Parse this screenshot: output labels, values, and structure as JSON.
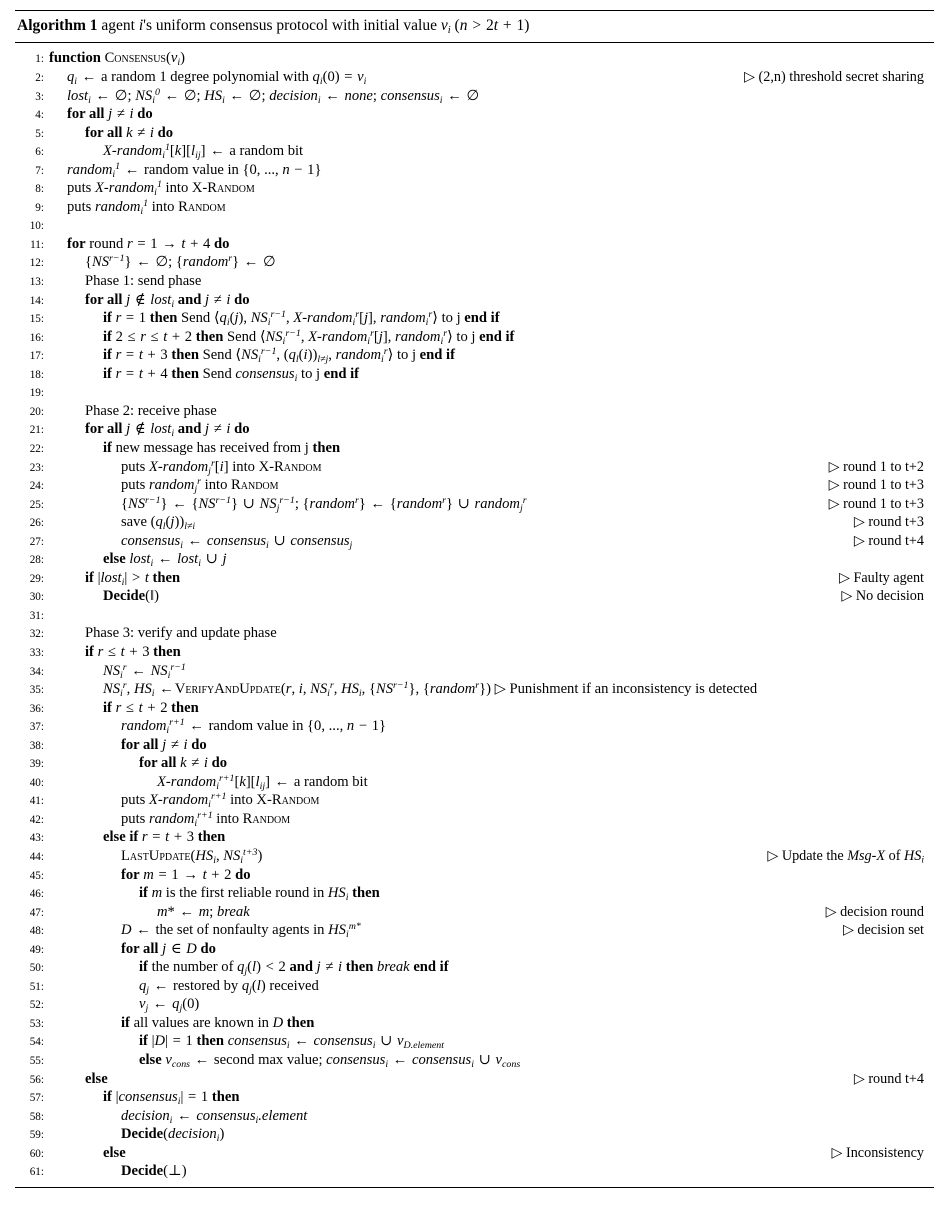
{
  "document": {
    "type": "algorithm-pseudocode",
    "caption": {
      "label": "Algorithm 1",
      "title": "agent i's uniform consensus protocol with initial value v_i (n > 2t + 1)"
    }
  },
  "algorithm": {
    "name": "Consensus",
    "argument": "v_i",
    "total_lines": 61,
    "lines": [
      {
        "n": "1",
        "indent": 0,
        "text": "function CONSENSUS(v_i)",
        "comment": ""
      },
      {
        "n": "2",
        "indent": 1,
        "text": "q_i <- a random 1 degree polynomial with q_i(0) = v_i",
        "comment": "(2,n) threshold secret sharing"
      },
      {
        "n": "3",
        "indent": 1,
        "text": "lost_i <- {}; NS_i^0 <- {}; HS_i <- {}; decision_i <- none; consensus_i <- {}",
        "comment": ""
      },
      {
        "n": "4",
        "indent": 1,
        "text": "for all j != i do",
        "comment": ""
      },
      {
        "n": "5",
        "indent": 2,
        "text": "for all k != i do",
        "comment": ""
      },
      {
        "n": "6",
        "indent": 3,
        "text": "X-random_i^1[k][l_ij] <- a random bit",
        "comment": ""
      },
      {
        "n": "7",
        "indent": 1,
        "text": "random_i^1 <- random value in {0, ..., n - 1}",
        "comment": ""
      },
      {
        "n": "8",
        "indent": 1,
        "text": "puts X-random_i^1 into X-RANDOM",
        "comment": ""
      },
      {
        "n": "9",
        "indent": 1,
        "text": "puts random_i^1 into RANDOM",
        "comment": ""
      },
      {
        "n": "10",
        "indent": 1,
        "text": "",
        "comment": ""
      },
      {
        "n": "11",
        "indent": 1,
        "text": "for round r = 1 -> t + 4 do",
        "comment": ""
      },
      {
        "n": "12",
        "indent": 2,
        "text": "{NS^{r-1}} <- {}; {random^r} <- {}",
        "comment": ""
      },
      {
        "n": "13",
        "indent": 2,
        "text": "Phase 1: send phase",
        "comment": ""
      },
      {
        "n": "14",
        "indent": 2,
        "text": "for all j not-in lost_i and j != i do",
        "comment": ""
      },
      {
        "n": "15",
        "indent": 3,
        "text": "if r = 1 then Send <q_i(j), NS_i^{r-1}, X-random_i^r[j], random_i^r> to j end if",
        "comment": ""
      },
      {
        "n": "16",
        "indent": 3,
        "text": "if 2 <= r <= t + 2 then Send <NS_i^{r-1}, X-random_i^r[j], random_i^r> to j end if",
        "comment": ""
      },
      {
        "n": "17",
        "indent": 3,
        "text": "if r = t + 3 then Send <NS_i^{r-1}, (q_l(i))_{l != j}, random_i^r> to j end if",
        "comment": ""
      },
      {
        "n": "18",
        "indent": 3,
        "text": "if r = t + 4 then Send consensus_i to j end if",
        "comment": ""
      },
      {
        "n": "19",
        "indent": 0,
        "text": "",
        "comment": ""
      },
      {
        "n": "20",
        "indent": 2,
        "text": "Phase 2: receive phase",
        "comment": ""
      },
      {
        "n": "21",
        "indent": 2,
        "text": "for all j not-in lost_i and j != i do",
        "comment": ""
      },
      {
        "n": "22",
        "indent": 3,
        "text": "if new message has received from j then",
        "comment": ""
      },
      {
        "n": "23",
        "indent": 4,
        "text": "puts X-random_j^r[i] into X-RANDOM",
        "comment": "round 1 to t+2"
      },
      {
        "n": "24",
        "indent": 4,
        "text": "puts random_j^r into RANDOM",
        "comment": "round 1 to t+3"
      },
      {
        "n": "25",
        "indent": 4,
        "text": "{NS^{r-1}} <- {NS^{r-1}} U NS_j^{r-1}; {random^r} <- {random^r} U random_j^r",
        "comment": "round 1 to t+3"
      },
      {
        "n": "26",
        "indent": 4,
        "text": "save (q_l(j))_{l != i}",
        "comment": "round t+3"
      },
      {
        "n": "27",
        "indent": 4,
        "text": "consensus_i <- consensus_i U consensus_j",
        "comment": "round t+4"
      },
      {
        "n": "28",
        "indent": 3,
        "text": "else lost_i <- lost_i U j",
        "comment": ""
      },
      {
        "n": "29",
        "indent": 2,
        "text": "if |lost_i| > t then",
        "comment": "Faulty agent"
      },
      {
        "n": "30",
        "indent": 3,
        "text": "Decide(||)",
        "comment": "No decision"
      },
      {
        "n": "31",
        "indent": 0,
        "text": "",
        "comment": ""
      },
      {
        "n": "32",
        "indent": 2,
        "text": "Phase 3: verify and update phase",
        "comment": ""
      },
      {
        "n": "33",
        "indent": 2,
        "text": "if r <= t + 3 then",
        "comment": ""
      },
      {
        "n": "34",
        "indent": 3,
        "text": "NS_i^r <- NS_i^{r-1}",
        "comment": ""
      },
      {
        "n": "35",
        "indent": 3,
        "text": "NS_i^r, HS_i <- VERIFYANDUPDATE(r, i, NS_i^r, HS_i, {NS^{r-1}}, {random^r})  > Punishment if an inconsistency is detected",
        "comment": ""
      },
      {
        "n": "36",
        "indent": 3,
        "text": "if r <= t + 2 then",
        "comment": ""
      },
      {
        "n": "37",
        "indent": 4,
        "text": "random_i^{r+1} <- random value in {0, ..., n - 1}",
        "comment": ""
      },
      {
        "n": "38",
        "indent": 4,
        "text": "for all j != i do",
        "comment": ""
      },
      {
        "n": "39",
        "indent": 5,
        "text": "for all k != i do",
        "comment": ""
      },
      {
        "n": "40",
        "indent": 6,
        "text": "X-random_i^{r+1}[k][l_ij] <- a random bit",
        "comment": ""
      },
      {
        "n": "41",
        "indent": 4,
        "text": "puts X-random_i^{r+1} into X-RANDOM",
        "comment": ""
      },
      {
        "n": "42",
        "indent": 4,
        "text": "puts random_i^{r+1} into RANDOM",
        "comment": ""
      },
      {
        "n": "43",
        "indent": 3,
        "text": "else if r = t + 3 then",
        "comment": ""
      },
      {
        "n": "44",
        "indent": 4,
        "text": "LASTUPDATE(HS_i, NS_i^{t+3})",
        "comment": "Update the Msg-X of HS_i"
      },
      {
        "n": "45",
        "indent": 4,
        "text": "for m = 1 -> t + 2 do",
        "comment": ""
      },
      {
        "n": "46",
        "indent": 5,
        "text": "if m is the first reliable round in HS_i then",
        "comment": ""
      },
      {
        "n": "47",
        "indent": 6,
        "text": "m* <- m; break",
        "comment": "decision round"
      },
      {
        "n": "48",
        "indent": 4,
        "text": "D <- the set of nonfaulty agents in HS_i^{m*}",
        "comment": "decision set"
      },
      {
        "n": "49",
        "indent": 4,
        "text": "for all j in D do",
        "comment": ""
      },
      {
        "n": "50",
        "indent": 5,
        "text": "if the number of q_j(l) < 2 and j != i then break end if",
        "comment": ""
      },
      {
        "n": "51",
        "indent": 5,
        "text": "q_j <- restored by q_j(l) received",
        "comment": ""
      },
      {
        "n": "52",
        "indent": 5,
        "text": "v_j <- q_j(0)",
        "comment": ""
      },
      {
        "n": "53",
        "indent": 4,
        "text": "if all values are known in D then",
        "comment": ""
      },
      {
        "n": "54",
        "indent": 5,
        "text": "if |D| = 1 then consensus_i <- consensus_i U v_{D.element}",
        "comment": ""
      },
      {
        "n": "55",
        "indent": 5,
        "text": "else v_cons <- second max value; consensus_i <- consensus_i U v_cons",
        "comment": ""
      },
      {
        "n": "56",
        "indent": 2,
        "text": "else",
        "comment": "round t+4"
      },
      {
        "n": "57",
        "indent": 3,
        "text": "if |consensus_i| = 1 then",
        "comment": ""
      },
      {
        "n": "58",
        "indent": 4,
        "text": "decision_i <- consensus_i.element",
        "comment": ""
      },
      {
        "n": "59",
        "indent": 4,
        "text": "Decide(decision_i)",
        "comment": ""
      },
      {
        "n": "60",
        "indent": 3,
        "text": "else",
        "comment": "Inconsistency"
      },
      {
        "n": "61",
        "indent": 4,
        "text": "Decide(⊥)",
        "comment": ""
      }
    ]
  },
  "comments": {
    "line2": "(2,n) threshold secret sharing",
    "line23": "round 1 to t+2",
    "line24": "round 1 to t+3",
    "line25": "round 1 to t+3",
    "line26": "round t+3",
    "line27": "round t+4",
    "line29": "Faulty agent",
    "line30": "No decision",
    "line35": "Punishment if an inconsistency is detected",
    "line44": "Update the Msg-X of HS_i",
    "line47": "decision round",
    "line48": "decision set",
    "line56": "round t+4",
    "line60": "Inconsistency"
  },
  "line_numbers": [
    "1",
    "2",
    "3",
    "4",
    "5",
    "6",
    "7",
    "8",
    "9",
    "10",
    "11",
    "12",
    "13",
    "14",
    "15",
    "16",
    "17",
    "18",
    "19",
    "20",
    "21",
    "22",
    "23",
    "24",
    "25",
    "26",
    "27",
    "28",
    "29",
    "30",
    "31",
    "32",
    "33",
    "34",
    "35",
    "36",
    "37",
    "38",
    "39",
    "40",
    "41",
    "42",
    "43",
    "44",
    "45",
    "46",
    "47",
    "48",
    "49",
    "50",
    "51",
    "52",
    "53",
    "54",
    "55",
    "56",
    "57",
    "58",
    "59",
    "60",
    "61"
  ]
}
